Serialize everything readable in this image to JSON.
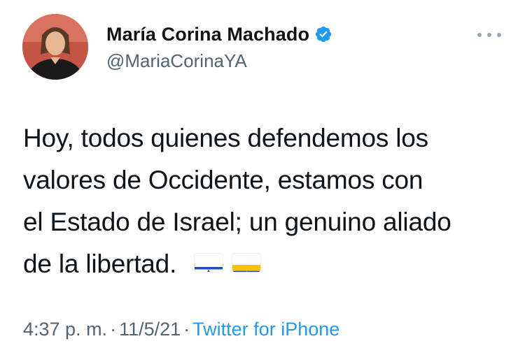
{
  "tweet": {
    "author": {
      "display_name": "María Corina Machado",
      "handle": "@MariaCorinaYA",
      "verified": true,
      "avatar_icon": "profile-photo"
    },
    "text_lines": [
      "Hoy, todos quienes defendemos los",
      "valores de Occidente, estamos con",
      "el Estado de Israel; un genuino aliado",
      "de la libertad."
    ],
    "flags": [
      "israel-flag-icon",
      "venezuela-flag-icon"
    ],
    "meta": {
      "time": "4:37 p. m.",
      "separator": "·",
      "date": "11/5/21",
      "source": "Twitter for iPhone"
    },
    "more_icon": "more-options-icon"
  },
  "colors": {
    "text_primary": "#0f1419",
    "text_secondary": "#536471",
    "accent": "#1d9bf0",
    "verified_badge": "#1d9bf0"
  }
}
